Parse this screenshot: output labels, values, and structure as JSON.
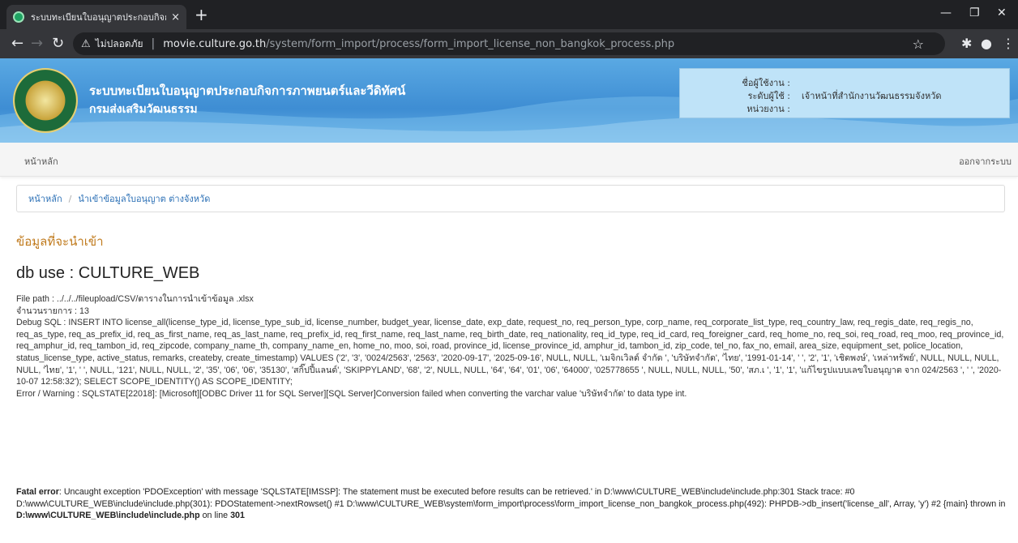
{
  "browser": {
    "tab_title": "ระบบทะเบียนใบอนุญาตประกอบกิจการฯ",
    "tab_close": "×",
    "new_tab": "+",
    "insecure_label": "ไม่ปลอดภัย",
    "url_host": "movie.culture.go.th",
    "url_path": "/system/form_import/process/form_import_license_non_bangkok_process.php",
    "icons": [
      "back-icon",
      "forward-icon",
      "reload-icon",
      "warning-icon",
      "star-icon",
      "extensions-icon",
      "profile-icon",
      "menu-icon"
    ]
  },
  "header": {
    "title": "ระบบทะเบียนใบอนุญาตประกอบกิจการภาพยนตร์และวีดิทัศน์",
    "subtitle": "กรมส่งเสริมวัฒนธรรม",
    "user_label": "ชื่อผู้ใช้งาน :",
    "level_label": "ระดับผู้ใช้ :",
    "level_value": "เจ้าหน้าที่สำนักงานวัฒนธรรมจังหวัด",
    "unit_label": "หน่วยงาน :"
  },
  "nav": {
    "home": "หน้าหลัก",
    "logout": "ออกจากระบบ"
  },
  "breadcrumb": {
    "home": "หน้าหลัก",
    "sep": "/",
    "current": "นำเข้าข้อมูลใบอนุญาต ต่างจังหวัด"
  },
  "content": {
    "section_title": "ข้อมูลที่จะนำเข้า",
    "db_use": "db use : CULTURE_WEB",
    "file_path": "File path : ../../../fileupload/CSV/ตารางในการนำเข้าข้อมูล          .xlsx",
    "count": "จำนวนรายการ : 13",
    "debug_sql": "Debug SQL : INSERT INTO license_all(license_type_id, license_type_sub_id, license_number, budget_year, license_date, exp_date, request_no, req_person_type, corp_name, req_corporate_list_type, req_country_law, req_regis_date, req_regis_no, req_as_type, req_as_prefix_id, req_as_first_name, req_as_last_name, req_prefix_id, req_first_name, req_last_name, req_birth_date, req_nationality, req_id_type, req_id_card, req_foreigner_card, req_home_no, req_soi, req_road, req_moo, req_province_id, req_amphur_id, req_tambon_id, req_zipcode, company_name_th, company_name_en, home_no, moo, soi, road, province_id, license_province_id, amphur_id, tambon_id, zip_code, tel_no, fax_no, email, area_size, equipment_set, police_location, status_license_type, active_status, remarks, createby, create_timestamp) VALUES ('2', '3', '0024/2563', '2563', '2020-09-17', '2025-09-16', NULL, NULL, 'เมจิกเวิลด์ จำกัด ', 'บริษัทจำกัด', 'ไทย', '1991-01-14', '              ', '2', '1', 'เชิดพงษ์', 'เหล่าทรัพย์', NULL, NULL, NULL, NULL, 'ไทย', '1', '              ', NULL, '121', NULL, NULL, '2', '35', '06', '06', '35130', 'สกิ๊ปปี้แลนด์', 'SKIPPYLAND', '68', '2', NULL, NULL, '64', '64', '01', '06', '64000', '025778655 ', NULL, NULL, NULL, '50', 'สภ.เ          ', '1', '1', 'แก้ไขรูปแบบเลขใบอนุญาต จาก 024/2563 ', '              ', '2020-10-07 12:58:32'); SELECT SCOPE_IDENTITY() AS SCOPE_IDENTITY;",
    "error": "Error / Warning : SQLSTATE[22018]: [Microsoft][ODBC Driver 11 for SQL Server][SQL Server]Conversion failed when converting the varchar value 'บริษัทจำกัด' to data type int."
  },
  "fatal": {
    "label": "Fatal error",
    "message": ": Uncaught exception 'PDOException' with message 'SQLSTATE[IMSSP]: The statement must be executed before results can be retrieved.' in D:\\www\\CULTURE_WEB\\include\\include.php:301 Stack trace: #0 D:\\www\\CULTURE_WEB\\include\\include.php(301): PDOStatement->nextRowset() #1 D:\\www\\CULTURE_WEB\\system\\form_import\\process\\form_import_license_non_bangkok_process.php(492): PHPDB->db_insert('license_all', Array, 'y') #2 {main} thrown in ",
    "file": "D:\\www\\CULTURE_WEB\\include\\include.php",
    "on_line": " on line ",
    "line_no": "301"
  }
}
